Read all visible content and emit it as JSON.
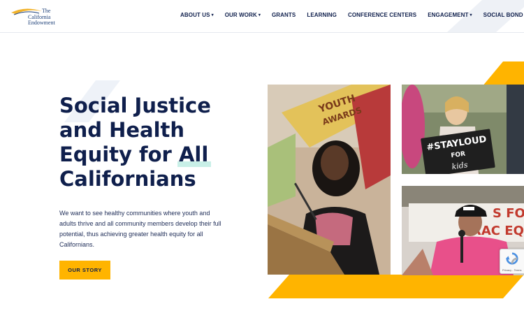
{
  "logo": {
    "line1": "The",
    "line2": "California",
    "line3": "Endowment"
  },
  "nav": {
    "items": [
      {
        "label": "ABOUT US",
        "dropdown": true
      },
      {
        "label": "OUR WORK",
        "dropdown": true
      },
      {
        "label": "GRANTS",
        "dropdown": false
      },
      {
        "label": "LEARNING",
        "dropdown": false
      },
      {
        "label": "CONFERENCE CENTERS",
        "dropdown": false
      },
      {
        "label": "ENGAGEMENT",
        "dropdown": true
      },
      {
        "label": "SOCIAL BOND",
        "dropdown": false
      }
    ],
    "caret": "▾"
  },
  "hero": {
    "title_lines": [
      "Social Justice",
      "and Health",
      "Equity for",
      "All",
      "Californians"
    ],
    "description": "We want to see healthy communities where youth and adults thrive and all community members develop their full potential, thus achieving greater health equity for all Californians.",
    "cta_label": "OUR STORY"
  },
  "photos": {
    "sign_stayloud_1": "#STAYLOUD",
    "sign_stayloud_2": "FOR",
    "sign_stayloud_3": "kids",
    "sign_rally_1": "S  FO",
    "sign_rally_2": "RAC   EQU",
    "sign_youth": "YOUTH",
    "sign_awards": "AWARDS"
  },
  "recaptcha": {
    "sub": "Privacy - Terms"
  },
  "colors": {
    "navy": "#0f1f4c",
    "accent_yellow": "#ffb400",
    "highlight_mint": "#c8efe7",
    "logo_blue": "#1c3f78",
    "logo_gold": "#f2b32b"
  }
}
